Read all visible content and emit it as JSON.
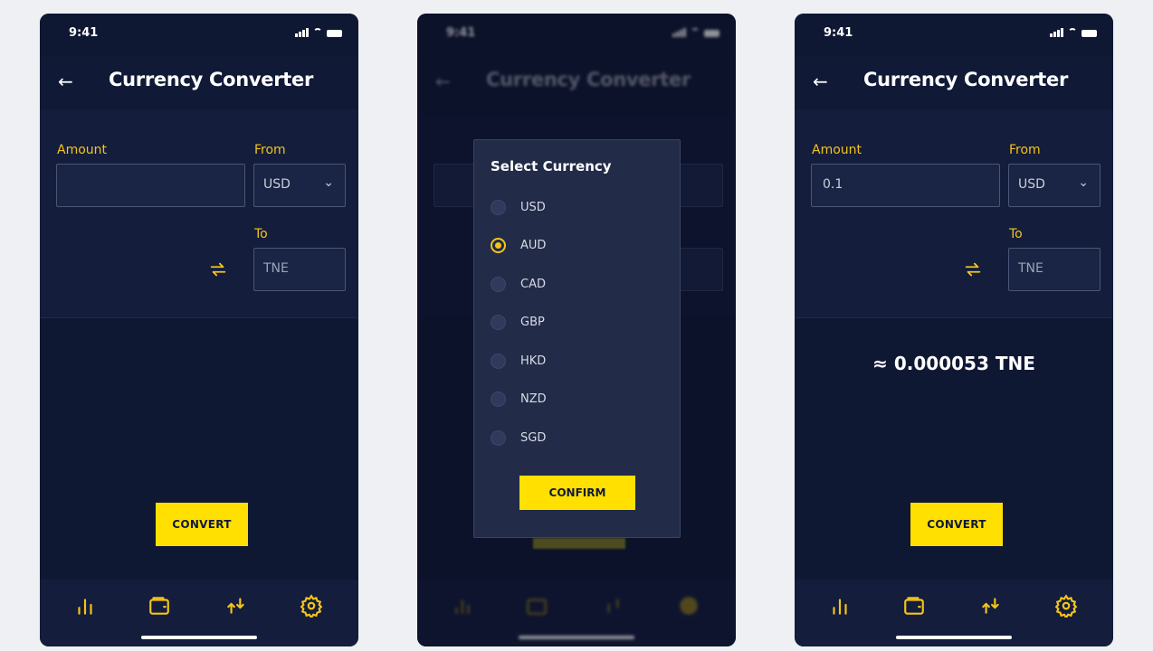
{
  "status_bar": {
    "time": "9:41"
  },
  "header": {
    "title": "Currency Converter"
  },
  "screens": [
    {
      "form": {
        "amount_label": "Amount",
        "amount_value": "",
        "from_label": "From",
        "from_value": "USD",
        "to_label": "To",
        "to_value": "TNE"
      },
      "convert_label": "CONVERT"
    },
    {
      "dialog": {
        "title": "Select Currency",
        "options": [
          "USD",
          "AUD",
          "CAD",
          "GBP",
          "HKD",
          "NZD",
          "SGD"
        ],
        "selected": "AUD",
        "confirm_label": "CONFIRM"
      }
    },
    {
      "form": {
        "amount_label": "Amount",
        "amount_value": "0.1",
        "from_label": "From",
        "from_value": "USD",
        "to_label": "To",
        "to_value": "TNE"
      },
      "result": "≈ 0.000053 TNE",
      "convert_label": "CONVERT"
    }
  ],
  "nav": {
    "items": [
      {
        "icon": "bar-chart-icon"
      },
      {
        "icon": "wallet-icon"
      },
      {
        "icon": "transfer-icon"
      },
      {
        "icon": "settings-icon"
      }
    ]
  },
  "colors": {
    "background": "#0f1833",
    "accent": "#ffe000",
    "label": "#f3c41a",
    "field_border": "#4a5675"
  }
}
